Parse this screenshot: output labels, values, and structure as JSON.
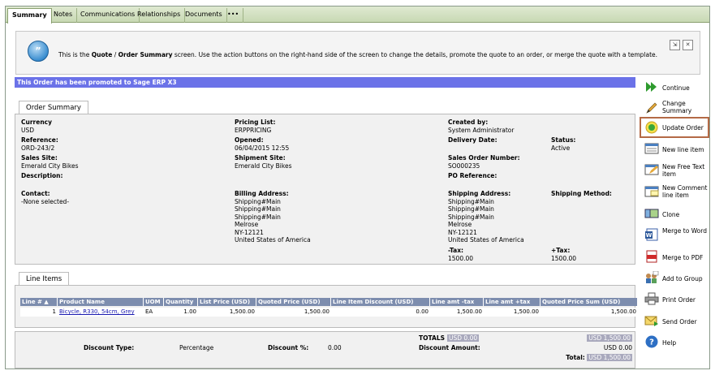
{
  "tabs": [
    "Summary",
    "Notes",
    "Communications",
    "Relationships",
    "Documents",
    "•••"
  ],
  "info": {
    "bubble": "”",
    "pre": "This is the ",
    "b1": "Quote",
    "sep": " / ",
    "b2": "Order Summary",
    "post": " screen. Use the action buttons on the right-hand side of the screen to change the details, promote the quote to an order, or merge the quote with a template.",
    "ctl1": "⇲",
    "ctl2": "✕"
  },
  "banner": "This Order has been promoted to Sage ERP X3",
  "order_summary": {
    "tab": "Order Summary",
    "currency_label": "Currency",
    "currency": "USD",
    "reference_label": "Reference:",
    "reference": "ORD-243/2",
    "sales_site_label": "Sales Site:",
    "sales_site": "Emerald City Bikes",
    "description_label": "Description:",
    "contact_label": "Contact:",
    "contact": "-None selected-",
    "pricing_list_label": "Pricing List:",
    "pricing_list": "ERPPRICING",
    "opened_label": "Opened:",
    "opened": "06/04/2015 12:55",
    "shipment_site_label": "Shipment Site:",
    "shipment_site": "Emerald City Bikes",
    "billing_label": "Billing Address:",
    "billing": [
      "Shipping#Main",
      "Shipping#Main",
      "Shipping#Main",
      "Melrose",
      "NY-12121",
      "United States of America"
    ],
    "created_by_label": "Created by:",
    "created_by": "System Administrator",
    "delivery_label": "Delivery Date:",
    "sales_order_label": "Sales Order Number:",
    "sales_order": "SO000235",
    "po_label": "PO Reference:",
    "shipping_label": "Shipping Address:",
    "shipping": [
      "Shipping#Main",
      "Shipping#Main",
      "Shipping#Main",
      "Melrose",
      "NY-12121",
      "United States of America"
    ],
    "minus_tax_label": "-Tax:",
    "minus_tax": "1500.00",
    "status_label": "Status:",
    "status": "Active",
    "ship_method_label": "Shipping Method:",
    "plus_tax_label": "+Tax:",
    "plus_tax": "1500.00"
  },
  "line_items": {
    "tab": "Line Items",
    "columns": [
      "Line # ▲",
      "Product Name",
      "UOM",
      "Quantity",
      "List Price (USD)",
      "Quoted Price (USD)",
      "Line Item Discount (USD)",
      "Line amt -tax",
      "Line amt +tax",
      "Quoted Price Sum (USD)"
    ],
    "rows": [
      [
        "1",
        "Bicycle, R330, 54cm, Grey",
        "EA",
        "1.00",
        "1,500.00",
        "1,500.00",
        "0.00",
        "1,500.00",
        "1,500.00",
        "1,500.00"
      ]
    ]
  },
  "totals": {
    "totals_label": "TOTALS",
    "totals_value": "USD 0.00",
    "right_top": "USD 1,500.00",
    "discount_type_label": "Discount Type:",
    "discount_type": "Percentage",
    "discount_pct_label": "Discount %:",
    "discount_pct": "0.00",
    "discount_amount_label": "Discount Amount:",
    "discount_amount": "USD 0.00",
    "total_label": "Total:",
    "total": "USD 1,500.00"
  },
  "actions": [
    {
      "label": "Continue",
      "icon": "continue-icon"
    },
    {
      "label": "Change Summary",
      "icon": "pencil-icon"
    },
    {
      "label": "Update Order",
      "icon": "update-order-icon"
    },
    {
      "label": "New line item",
      "icon": "new-line-item-icon"
    },
    {
      "label": "New Free Text item",
      "icon": "free-text-icon"
    },
    {
      "label": "New Comment line item",
      "icon": "comment-line-icon"
    },
    {
      "label": "Clone",
      "icon": "clone-icon"
    },
    {
      "label": "Merge to Word",
      "icon": "word-icon"
    },
    {
      "label": "Merge to PDF",
      "icon": "pdf-icon"
    },
    {
      "label": "Add to Group",
      "icon": "group-icon"
    },
    {
      "label": "Print Order",
      "icon": "printer-icon"
    },
    {
      "label": "Send Order",
      "icon": "envelope-icon"
    },
    {
      "label": "Help",
      "icon": "help-icon"
    }
  ],
  "colors": {
    "banner": "#6b72e8",
    "tabbar": "#c8d9b4",
    "grid_header": "#7d8dae",
    "selected_action_border": "#b46a46"
  }
}
